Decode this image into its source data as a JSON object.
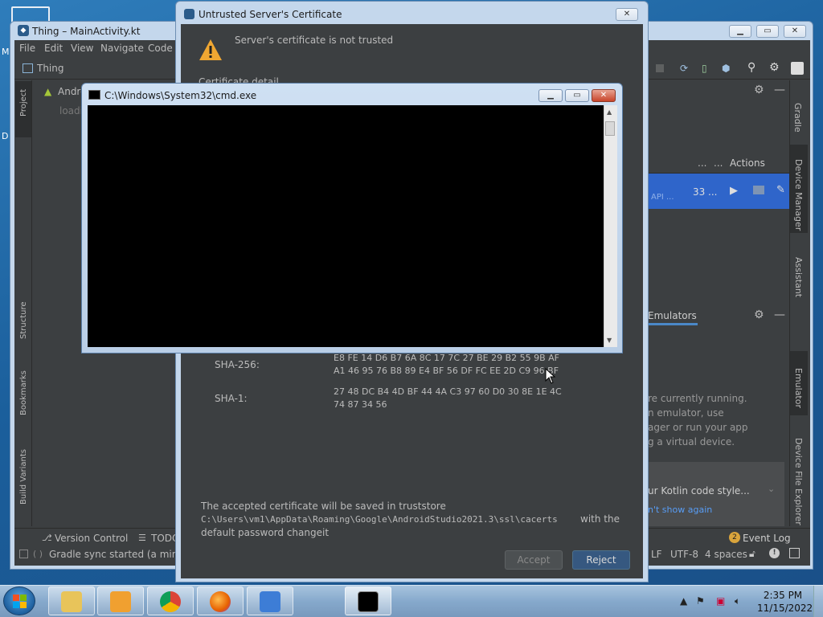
{
  "desktop": {
    "label_1": "M",
    "label_2": "D"
  },
  "android_studio": {
    "window_title": "Thing – MainActivity.kt",
    "menu": [
      "File",
      "Edit",
      "View",
      "Navigate",
      "Code"
    ],
    "project_name": "Thing",
    "tree_root": "Andro",
    "tree_loading": "loadi",
    "left_tabs": {
      "project": "Project",
      "structure": "Structure",
      "bookmarks": "Bookmarks",
      "build_variants": "Build Variants"
    },
    "right_tabs": {
      "gradle": "Gradle",
      "device_manager": "Device Manager",
      "assistant": "Assistant",
      "emulator": "Emulator",
      "device_file_explorer": "Device File Explorer"
    },
    "device_manager": {
      "columns": [
        "...",
        "...",
        "Actions"
      ],
      "row": {
        "api": "API ...",
        "size": "33",
        "more": "..."
      }
    },
    "emulator": {
      "tab": "Emulators",
      "lines": [
        "re currently running.",
        "n emulator, use",
        "ager or run your app",
        "g a virtual device."
      ],
      "link_fragment": "ager"
    },
    "notification": {
      "text": "ur Kotlin code style...",
      "link": "n't show again"
    },
    "bottom_tabs": {
      "version_control": "Version Control",
      "todo": "TODO"
    },
    "event_log": {
      "count": "2",
      "label": "Event Log"
    },
    "status": {
      "message": "Gradle sync started (a minute",
      "line_sep": "LF",
      "encoding": "UTF-8",
      "indent": "4 spaces"
    }
  },
  "certificate_dialog": {
    "title": "Untrusted Server's Certificate",
    "heading": "Server's certificate is not trusted",
    "partial_heading": "Certificate detail",
    "sha256_label": "SHA-256:",
    "sha256_line1": "E8 FE 14 D6 B7 6A 8C 17 7C 27 BE 29 B2 55 9B AF",
    "sha256_line2": "A1 46 95 76 B8 89 E4 BF 56 DF FC EE 2D C9 96 BF",
    "sha1_label": "SHA-1:",
    "sha1_line1": "27 48 DC B4 4D BF 44 4A C3 97 60 D0 30 8E 1E 4C",
    "sha1_line2": "74 87 34 56",
    "save_note": "The accepted certificate will be saved in truststore",
    "truststore_path": "C:\\Users\\vm1\\AppData\\Roaming\\Google\\AndroidStudio2021.3\\ssl\\cacerts",
    "with_the": "with the",
    "password_note": "default password changeit",
    "accept_label": "Accept",
    "reject_label": "Reject"
  },
  "cmd": {
    "title": "C:\\Windows\\System32\\cmd.exe"
  },
  "taskbar": {
    "time": "2:35 PM",
    "date": "11/15/2022"
  },
  "colors": {
    "ide_bg": "#3c3f41",
    "selection": "#2f65ca",
    "reject_button": "#365880",
    "link": "#589df6",
    "warning": "#f0a732"
  }
}
